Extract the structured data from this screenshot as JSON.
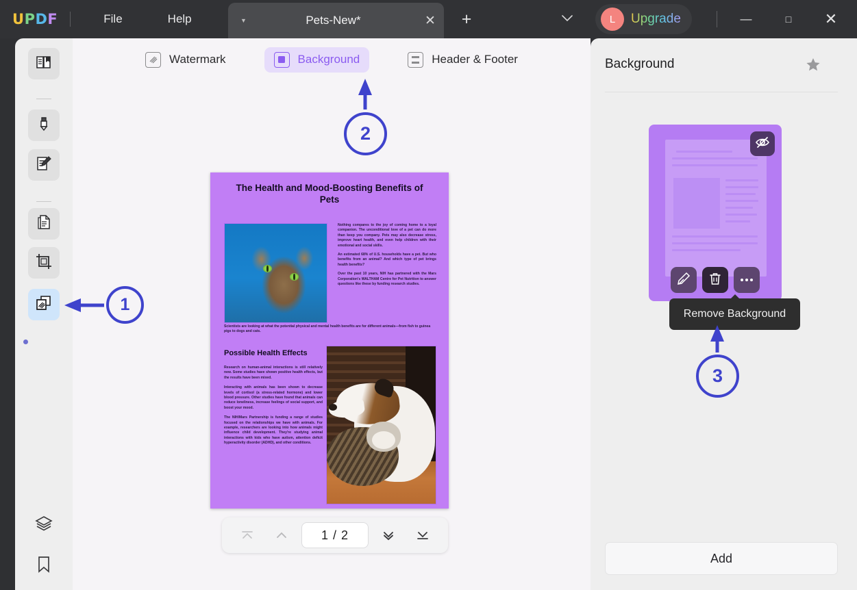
{
  "titlebar": {
    "logo": [
      "U",
      "P",
      "D",
      "F"
    ],
    "menus": [
      {
        "label": "File",
        "name": "menu-file"
      },
      {
        "label": "Help",
        "name": "menu-help"
      }
    ],
    "tab": {
      "title": "Pets-New*",
      "caret": "▼",
      "close": "✕"
    },
    "new_tab": "+",
    "tab_list_caret": "⌄",
    "upgrade": {
      "avatar_letter": "L",
      "label": "Upgrade"
    },
    "window": {
      "minimize": "—",
      "maximize": "□",
      "close": "✕"
    }
  },
  "sidebar": {
    "items": [
      {
        "name": "reader-icon",
        "label": "Reader"
      },
      {
        "name": "comment-highlighter-icon",
        "label": "Comment"
      },
      {
        "name": "edit-pdf-icon",
        "label": "Edit PDF"
      },
      {
        "name": "organize-pages-icon",
        "label": "Organize Pages"
      },
      {
        "name": "crop-page-icon",
        "label": "Crop Page"
      },
      {
        "name": "watermark-background-icon",
        "label": "Watermark & Background"
      },
      {
        "name": "layers-icon",
        "label": "Layers"
      },
      {
        "name": "bookmark-icon",
        "label": "Bookmark"
      }
    ]
  },
  "toolbar": {
    "tabs": [
      {
        "label": "Watermark",
        "icon": "watermark-icon",
        "selected": false
      },
      {
        "label": "Background",
        "icon": "background-icon",
        "selected": true
      },
      {
        "label": "Header & Footer",
        "icon": "header-footer-icon",
        "selected": false
      }
    ]
  },
  "document": {
    "title": "The Health and Mood-Boosting Benefits of Pets",
    "intro_paragraphs": [
      "Nothing compares to the joy of coming home to a loyal companion. The unconditional love of a pet can do more than keep you company. Pets may also decrease stress, improve heart health, and even help children with their emotional and social skills.",
      "An estimated 68% of U.S. households have a pet. But who benefits from an animal? And which type of pet brings health benefits?",
      "Over the past 10 years, NIH has partnered with the Mars Corporation's WALTHAM Centre for Pet Nutrition to answer questions like these by funding research studies."
    ],
    "span_paragraph": "Scientists are looking at what the potential physical and mental health benefits are for different animals—from fish to guinea pigs to dogs and cats.",
    "section_title": "Possible Health Effects",
    "section_paragraphs": [
      "Research on human-animal interactions is still relatively new. Some studies have shown positive health effects, but the results have been mixed.",
      "Interacting with animals has been shown to decrease levels of cortisol (a stress-related hormone) and lower blood pressure. Other studies have found that animals can reduce loneliness, increase feelings of social support, and boost your mood.",
      "The NIH/Mars Partnership is funding a range of studies focused on the relationships we have with animals. For example, researchers are looking into how animals might influence child development. They're studying animal interactions with kids who have autism, attention deficit hyperactivity disorder (ADHD), and other conditions."
    ]
  },
  "page_nav": {
    "first_page": "first-page-icon",
    "prev_page": "prev-page-icon",
    "value": "1 / 2",
    "next_page": "next-page-icon",
    "last_page": "last-page-icon"
  },
  "right_panel": {
    "title": "Background",
    "favorite_icon": "star-icon",
    "thumbnail": {
      "hide_icon": "eye-slash-icon",
      "actions": [
        {
          "name": "edit-background-button",
          "icon": "pencil-icon",
          "highlighted": false
        },
        {
          "name": "remove-background-button",
          "icon": "trash-icon",
          "highlighted": true
        },
        {
          "name": "more-options-button",
          "icon": "ellipsis-icon",
          "highlighted": false
        }
      ]
    },
    "tooltip": "Remove Background",
    "add_button": "Add"
  },
  "annotations": {
    "color": "#3f43cc",
    "steps": [
      {
        "number": "1",
        "points_to": "watermark-background-sidebar-icon"
      },
      {
        "number": "2",
        "points_to": "background-toolbar-tab"
      },
      {
        "number": "3",
        "points_to": "remove-background-tooltip"
      }
    ]
  }
}
